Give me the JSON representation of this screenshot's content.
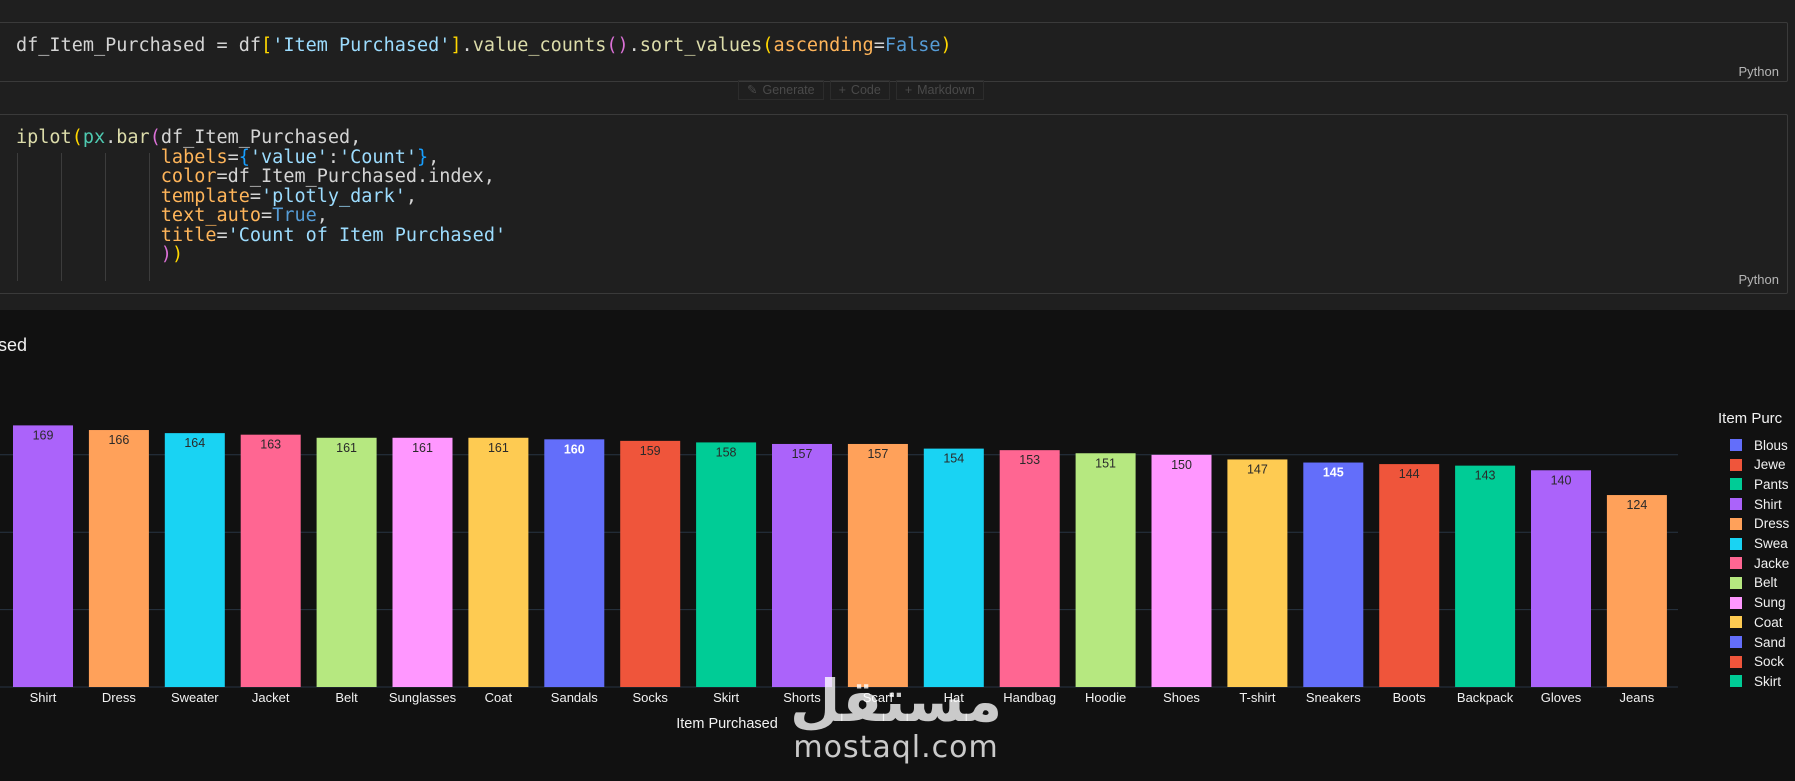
{
  "cell1": {
    "code": "df_Item_Purchased = df['Item Purchased'].value_counts().sort_values(ascending=False)",
    "language": "Python"
  },
  "toolbar": {
    "generate_label": "Generate",
    "code_label": "Code",
    "markdown_label": "Markdown"
  },
  "cell2": {
    "lines": [
      "iplot(px.bar(df_Item_Purchased,",
      "             labels={'value':'Count'},",
      "             color=df_Item_Purchased.index,",
      "             template='plotly_dark',",
      "             text_auto=True,",
      "             title='Count of Item Purchased'",
      "             ))"
    ],
    "language": "Python"
  },
  "output": {
    "title_visible": "sed",
    "xaxis_title": "Item Purchased",
    "legend_title": "Item Purc",
    "legend_items": [
      {
        "label": "Blous",
        "color": "#636efa"
      },
      {
        "label": "Jewe",
        "color": "#ef553b"
      },
      {
        "label": "Pants",
        "color": "#00cc96"
      },
      {
        "label": "Shirt",
        "color": "#ab63fa"
      },
      {
        "label": "Dress",
        "color": "#ffa15a"
      },
      {
        "label": "Swea",
        "color": "#19d3f3"
      },
      {
        "label": "Jacke",
        "color": "#ff6692"
      },
      {
        "label": "Belt",
        "color": "#b6e880"
      },
      {
        "label": "Sung",
        "color": "#ff97ff"
      },
      {
        "label": "Coat",
        "color": "#fecb52"
      },
      {
        "label": "Sand",
        "color": "#636efa"
      },
      {
        "label": "Sock",
        "color": "#ef553b"
      },
      {
        "label": "Skirt",
        "color": "#00cc96"
      }
    ]
  },
  "chart_data": {
    "type": "bar",
    "title": "",
    "xlabel": "Item Purchased",
    "ylabel": "",
    "categories": [
      "Shirt",
      "Dress",
      "Sweater",
      "Jacket",
      "Belt",
      "Sunglasses",
      "Coat",
      "Sandals",
      "Socks",
      "Skirt",
      "Shorts",
      "Scarf",
      "Hat",
      "Handbag",
      "Hoodie",
      "Shoes",
      "T-shirt",
      "Sneakers",
      "Boots",
      "Backpack",
      "Gloves",
      "Jeans"
    ],
    "values": [
      169,
      166,
      164,
      163,
      161,
      161,
      161,
      160,
      159,
      158,
      157,
      157,
      154,
      153,
      151,
      150,
      147,
      145,
      144,
      143,
      140,
      124
    ],
    "colors": [
      "#ab63fa",
      "#ffa15a",
      "#19d3f3",
      "#ff6692",
      "#b6e880",
      "#ff97ff",
      "#fecb52",
      "#636efa",
      "#ef553b",
      "#00cc96",
      "#ab63fa",
      "#ffa15a",
      "#19d3f3",
      "#ff6692",
      "#b6e880",
      "#ff97ff",
      "#fecb52",
      "#636efa",
      "#ef553b",
      "#00cc96",
      "#ab63fa",
      "#ffa15a"
    ],
    "light_text_indices": [
      7,
      17
    ],
    "ylim": [
      0,
      178
    ],
    "gridlines": [
      50,
      100,
      150
    ],
    "template": "plotly_dark"
  },
  "watermark": {
    "arabic": "مستقل",
    "latin": "mostaql.com"
  }
}
